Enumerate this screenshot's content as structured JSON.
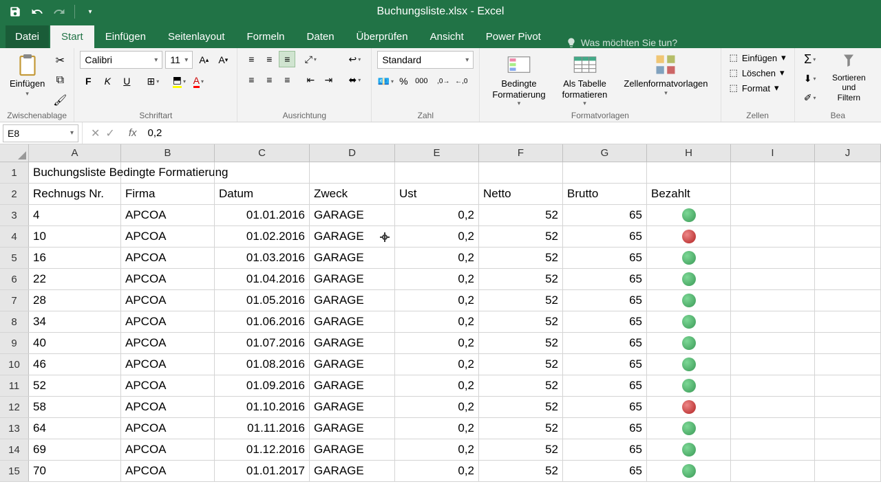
{
  "title": "Buchungsliste.xlsx - Excel",
  "tabs": {
    "file": "Datei",
    "start": "Start",
    "einfuegen": "Einfügen",
    "seitenlayout": "Seitenlayout",
    "formeln": "Formeln",
    "daten": "Daten",
    "ueberpruefen": "Überprüfen",
    "ansicht": "Ansicht",
    "powerpivot": "Power Pivot"
  },
  "tellme": "Was möchten Sie tun?",
  "ribbon": {
    "clipboard": {
      "paste": "Einfügen",
      "label": "Zwischenablage"
    },
    "font": {
      "name": "Calibri",
      "size": "11",
      "label": "Schriftart"
    },
    "alignment": {
      "label": "Ausrichtung"
    },
    "number": {
      "format": "Standard",
      "label": "Zahl"
    },
    "styles": {
      "conditional": "Bedingte\nFormatierung",
      "table": "Als Tabelle\nformatieren",
      "cell": "Zellenformatvorlagen",
      "label": "Formatvorlagen"
    },
    "cells": {
      "insert": "Einfügen",
      "delete": "Löschen",
      "format": "Format",
      "label": "Zellen"
    },
    "editing": {
      "sort": "Sortieren und\nFiltern",
      "label": "Bea"
    }
  },
  "formula": {
    "cellref": "E8",
    "value": "0,2"
  },
  "columns": [
    "A",
    "B",
    "C",
    "D",
    "E",
    "F",
    "G",
    "H",
    "I",
    "J"
  ],
  "sheet": {
    "title": "Buchungsliste Bedingte Formatierung",
    "headers": {
      "a": "Rechnugs Nr.",
      "b": "Firma",
      "c": "Datum",
      "d": "Zweck",
      "e": "Ust",
      "f": "Netto",
      "g": "Brutto",
      "h": "Bezahlt"
    },
    "rows": [
      {
        "nr": "4",
        "firma": "APCOA",
        "datum": "01.01.2016",
        "zweck": "GARAGE",
        "ust": "0,2",
        "netto": "52",
        "brutto": "65",
        "status": "green"
      },
      {
        "nr": "10",
        "firma": "APCOA",
        "datum": "01.02.2016",
        "zweck": "GARAGE",
        "ust": "0,2",
        "netto": "52",
        "brutto": "65",
        "status": "red"
      },
      {
        "nr": "16",
        "firma": "APCOA",
        "datum": "01.03.2016",
        "zweck": "GARAGE",
        "ust": "0,2",
        "netto": "52",
        "brutto": "65",
        "status": "green"
      },
      {
        "nr": "22",
        "firma": "APCOA",
        "datum": "01.04.2016",
        "zweck": "GARAGE",
        "ust": "0,2",
        "netto": "52",
        "brutto": "65",
        "status": "green"
      },
      {
        "nr": "28",
        "firma": "APCOA",
        "datum": "01.05.2016",
        "zweck": "GARAGE",
        "ust": "0,2",
        "netto": "52",
        "brutto": "65",
        "status": "green"
      },
      {
        "nr": "34",
        "firma": "APCOA",
        "datum": "01.06.2016",
        "zweck": "GARAGE",
        "ust": "0,2",
        "netto": "52",
        "brutto": "65",
        "status": "green"
      },
      {
        "nr": "40",
        "firma": "APCOA",
        "datum": "01.07.2016",
        "zweck": "GARAGE",
        "ust": "0,2",
        "netto": "52",
        "brutto": "65",
        "status": "green"
      },
      {
        "nr": "46",
        "firma": "APCOA",
        "datum": "01.08.2016",
        "zweck": "GARAGE",
        "ust": "0,2",
        "netto": "52",
        "brutto": "65",
        "status": "green"
      },
      {
        "nr": "52",
        "firma": "APCOA",
        "datum": "01.09.2016",
        "zweck": "GARAGE",
        "ust": "0,2",
        "netto": "52",
        "brutto": "65",
        "status": "green"
      },
      {
        "nr": "58",
        "firma": "APCOA",
        "datum": "01.10.2016",
        "zweck": "GARAGE",
        "ust": "0,2",
        "netto": "52",
        "brutto": "65",
        "status": "red"
      },
      {
        "nr": "64",
        "firma": "APCOA",
        "datum": "01.11.2016",
        "zweck": "GARAGE",
        "ust": "0,2",
        "netto": "52",
        "brutto": "65",
        "status": "green"
      },
      {
        "nr": "69",
        "firma": "APCOA",
        "datum": "01.12.2016",
        "zweck": "GARAGE",
        "ust": "0,2",
        "netto": "52",
        "brutto": "65",
        "status": "green"
      },
      {
        "nr": "70",
        "firma": "APCOA",
        "datum": "01.01.2017",
        "zweck": "GARAGE",
        "ust": "0,2",
        "netto": "52",
        "brutto": "65",
        "status": "green"
      }
    ]
  }
}
